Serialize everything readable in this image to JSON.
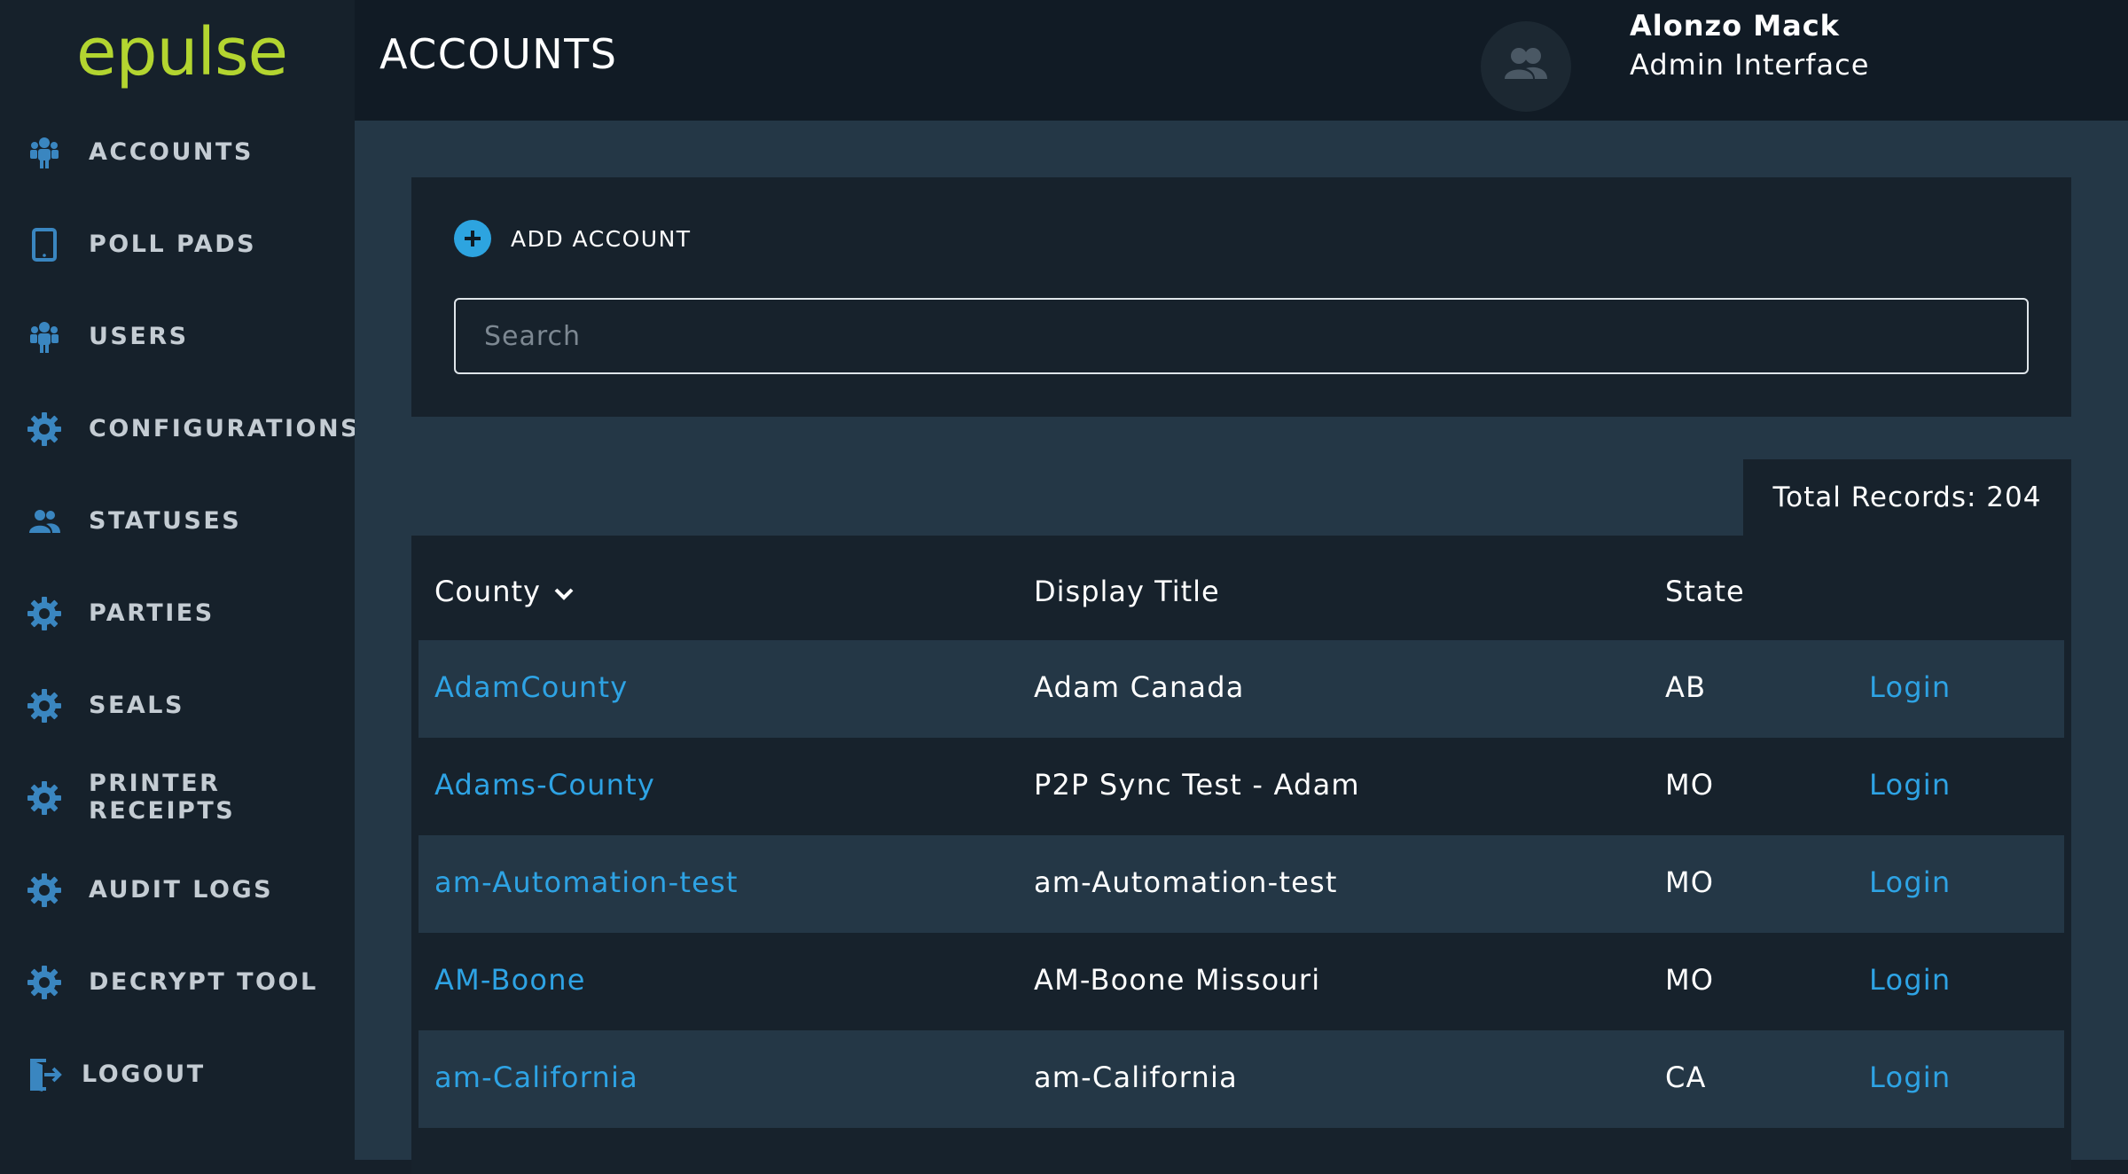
{
  "app": {
    "logo": "epulse"
  },
  "sidebar": {
    "items": [
      {
        "label": "ACCOUNTS",
        "icon": "users-group-icon"
      },
      {
        "label": "POLL PADS",
        "icon": "tablet-icon"
      },
      {
        "label": "USERS",
        "icon": "users-group-icon"
      },
      {
        "label": "CONFIGURATIONS",
        "icon": "gear-icon"
      },
      {
        "label": "STATUSES",
        "icon": "people-icon"
      },
      {
        "label": "PARTIES",
        "icon": "gear-icon"
      },
      {
        "label": "SEALS",
        "icon": "gear-icon"
      },
      {
        "label": "PRINTER RECEIPTS",
        "icon": "gear-icon"
      },
      {
        "label": "AUDIT LOGS",
        "icon": "gear-icon"
      },
      {
        "label": "DECRYPT TOOL",
        "icon": "gear-icon"
      },
      {
        "label": "LOGOUT",
        "icon": "logout-icon"
      }
    ]
  },
  "header": {
    "title": "ACCOUNTS",
    "user_name": "Alonzo Mack",
    "user_role": "Admin Interface"
  },
  "toolbar": {
    "add_label": "ADD ACCOUNT",
    "search_placeholder": "Search",
    "search_value": ""
  },
  "table": {
    "total_records": "Total Records: 204",
    "columns": {
      "county": "County",
      "display_title": "Display Title",
      "state": "State"
    },
    "rows": [
      {
        "county": "AdamCounty",
        "display_title": "Adam Canada",
        "state": "AB",
        "action": "Login"
      },
      {
        "county": "Adams-County",
        "display_title": "P2P Sync Test - Adam",
        "state": "MO",
        "action": "Login"
      },
      {
        "county": "am-Automation-test",
        "display_title": "am-Automation-test",
        "state": "MO",
        "action": "Login"
      },
      {
        "county": "AM-Boone",
        "display_title": "AM-Boone Missouri",
        "state": "MO",
        "action": "Login"
      },
      {
        "county": "am-California",
        "display_title": "am-California",
        "state": "CA",
        "action": "Login"
      }
    ]
  },
  "colors": {
    "accent": "#2ea3e4",
    "logo": "#b3d530",
    "sidebar_icon": "#3a86c0"
  }
}
